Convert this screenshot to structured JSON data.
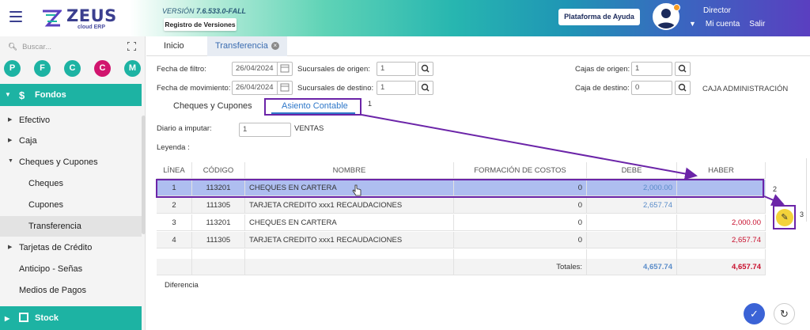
{
  "header": {
    "version_prefix": "VERSIÓN",
    "version_value": "7.6.533.0-FALL",
    "versions_button": "Registro de Versiones",
    "help_button": "Plataforma de Ayuda",
    "logo_text": "ZEUS",
    "logo_sub": "cloud ERP",
    "user_role": "Director",
    "account_link": "Mi cuenta",
    "logout_link": "Salir"
  },
  "sidebar": {
    "search_placeholder": "Buscar...",
    "quick_buttons": [
      {
        "letter": "P",
        "color": "#1db3a3"
      },
      {
        "letter": "F",
        "color": "#1db3a3"
      },
      {
        "letter": "C",
        "color": "#1db3a3"
      },
      {
        "letter": "C",
        "color": "#d1156e"
      },
      {
        "letter": "M",
        "color": "#1db3a3"
      }
    ],
    "section_title": "Fondos",
    "items": [
      {
        "label": "Efectivo"
      },
      {
        "label": "Caja"
      },
      {
        "label": "Cheques y Cupones"
      },
      {
        "label": "Cheques"
      },
      {
        "label": "Cupones"
      },
      {
        "label": "Transferencia"
      },
      {
        "label": "Tarjetas de Crédito"
      },
      {
        "label": "Anticipo - Señas"
      },
      {
        "label": "Medios de Pagos"
      }
    ],
    "bottom_section": "Stock"
  },
  "tabs": [
    {
      "label": "Inicio"
    },
    {
      "label": "Transferencia"
    }
  ],
  "form": {
    "fecha_filtro_label": "Fecha de filtro:",
    "fecha_filtro_value": "26/04/2024",
    "fecha_mov_label": "Fecha de movimiento:",
    "fecha_mov_value": "26/04/2024",
    "suc_origen_label": "Sucursales de origen:",
    "suc_origen_value": "1",
    "suc_destino_label": "Sucursales de destino:",
    "suc_destino_value": "1",
    "cajas_origen_label": "Cajas de origen:",
    "cajas_origen_value": "1",
    "caja_destino_label": "Caja de destino:",
    "caja_destino_value": "0",
    "caja_destino_name": "CAJA ADMINISTRACIÓN"
  },
  "subtabs": [
    {
      "label": "Cheques y Cupones"
    },
    {
      "label": "Asiento Contable"
    }
  ],
  "diario": {
    "label": "Diario a imputar:",
    "value": "1",
    "name": "VENTAS"
  },
  "leyenda_label": "Leyenda :",
  "table": {
    "headers": [
      "LÍNEA",
      "CÓDIGO",
      "NOMBRE",
      "FORMACIÓN DE COSTOS",
      "DEBE",
      "HABER"
    ],
    "rows": [
      {
        "linea": "1",
        "codigo": "113201",
        "nombre": "CHEQUES EN CARTERA",
        "costos": "0",
        "debe": "2,000.00",
        "haber": ""
      },
      {
        "linea": "2",
        "codigo": "111305",
        "nombre": "TARJETA CREDITO xxx1 RECAUDACIONES",
        "costos": "0",
        "debe": "2,657.74",
        "haber": ""
      },
      {
        "linea": "3",
        "codigo": "113201",
        "nombre": "CHEQUES EN CARTERA",
        "costos": "0",
        "debe": "",
        "haber": "2,000.00"
      },
      {
        "linea": "4",
        "codigo": "111305",
        "nombre": "TARJETA CREDITO xxx1 RECAUDACIONES",
        "costos": "0",
        "debe": "",
        "haber": "2,657.74"
      }
    ],
    "totals_label": "Totales:",
    "total_debe": "4,657.74",
    "total_haber": "4,657.74"
  },
  "diferencia_label": "Diferencia",
  "annotations": [
    "1",
    "2",
    "3"
  ],
  "colors": {
    "accent": "#1db3a3",
    "annotation": "#6b24a8",
    "selected_row": "#aebef0",
    "debe": "#5a8cc9",
    "haber": "#c8102e"
  }
}
